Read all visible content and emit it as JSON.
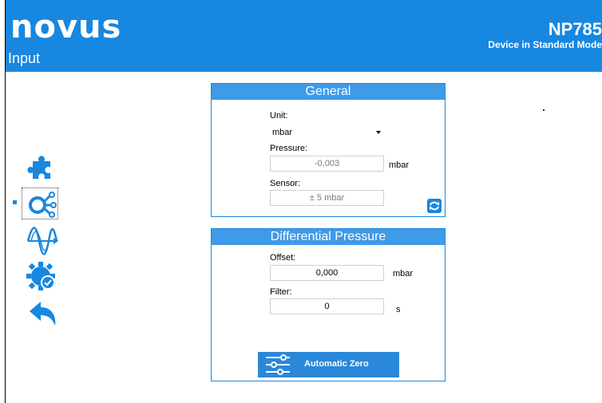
{
  "header": {
    "logo": "novus",
    "page_title": "Input",
    "model": "NP785",
    "mode": "Device in Standard Mode"
  },
  "nav": {
    "items": [
      {
        "icon": "puzzle-icon"
      },
      {
        "icon": "input-sensor-icon",
        "selected": true
      },
      {
        "icon": "waveform-icon"
      },
      {
        "icon": "gear-check-icon"
      },
      {
        "icon": "back-arrow-icon"
      }
    ]
  },
  "general": {
    "title": "General",
    "unit_label": "Unit:",
    "unit_value": "mbar",
    "pressure_label": "Pressure:",
    "pressure_value": "-0,003",
    "pressure_unit": "mbar",
    "sensor_label": "Sensor:",
    "sensor_value": "± 5 mbar",
    "refresh_icon": "refresh-icon"
  },
  "differential": {
    "title": "Differential Pressure",
    "offset_label": "Offset:",
    "offset_value": "0,000",
    "offset_unit": "mbar",
    "filter_label": "Filter:",
    "filter_value": "0",
    "filter_unit": "s",
    "auto_zero_label": "Automatic Zero",
    "auto_zero_icon": "sliders-icon"
  },
  "colors": {
    "brand": "#1787e0",
    "panel_header": "#3f9ae8"
  }
}
